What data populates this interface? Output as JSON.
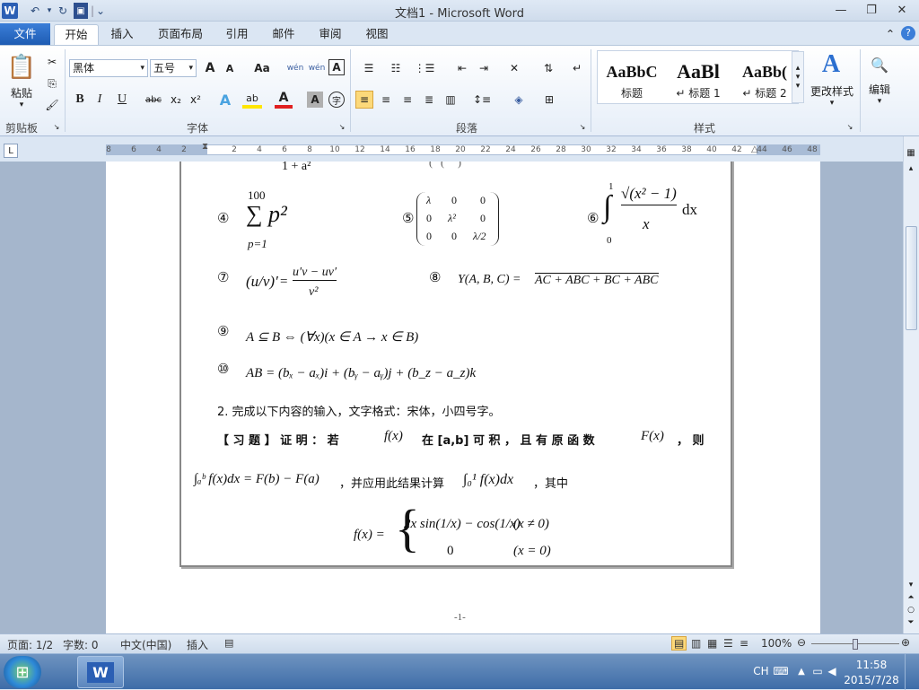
{
  "window": {
    "title": "文档1 - Microsoft Word",
    "app_icon": "W",
    "qat_separator": "|",
    "qat_more": "⌄",
    "controls": {
      "minimize": "—",
      "restore": "❐",
      "close": "✕"
    }
  },
  "tabs": [
    "文件",
    "开始",
    "插入",
    "页面布局",
    "引用",
    "邮件",
    "审阅",
    "视图"
  ],
  "ribbon": {
    "clipboard": {
      "paste": "粘贴",
      "group": "剪贴板"
    },
    "font": {
      "name": "黑体",
      "size": "五号",
      "group": "字体",
      "grow": "A",
      "shrink": "A",
      "change_case": "Aa",
      "clear_format": "wén",
      "phonetic": "wén",
      "border_char": "A",
      "bold": "B",
      "italic": "I",
      "underline": "U",
      "strike": "abc",
      "sub": "x₂",
      "sup": "x²",
      "effects": "A",
      "highlight": "ab",
      "font_color": "A",
      "char_shade": "A",
      "enclose": "字"
    },
    "paragraph": {
      "group": "段落"
    },
    "styles": {
      "group": "样式",
      "items": [
        {
          "sample": "AaBbC",
          "label": "标题"
        },
        {
          "sample": "AaBl",
          "label": "↵ 标题 1"
        },
        {
          "sample": "AaBb(",
          "label": "↵ 标题 2"
        }
      ],
      "change_styles": "更改样式"
    },
    "editing": {
      "group": "编辑",
      "binoculars": "🔍"
    }
  },
  "ruler": {
    "ticks": [
      "8",
      "6",
      "4",
      "2",
      "2",
      "4",
      "6",
      "8",
      "10",
      "12",
      "14",
      "16",
      "18",
      "20",
      "22",
      "24",
      "26",
      "28",
      "30",
      "32",
      "34",
      "36",
      "38",
      "40",
      "42",
      "44",
      "46",
      "48"
    ]
  },
  "document": {
    "cutoff_line": "1 + a²",
    "eq4_label": "④",
    "eq4_top": "100",
    "eq4_body": "∑ p²",
    "eq4_bottom": "p=1",
    "eq5_label": "⑤",
    "eq5_matrix": [
      [
        "λ",
        "0",
        "0"
      ],
      [
        "0",
        "λ²",
        "0"
      ],
      [
        "0",
        "0",
        "λ/2"
      ]
    ],
    "eq6_label": "⑥",
    "eq6_upper": "1",
    "eq6_lower": "0",
    "eq6_num": "√(x² − 1)",
    "eq6_den": "x",
    "eq6_dx": "dx",
    "eq7_label": "⑦",
    "eq7_lhs": "(u/v)′",
    "eq7_eq": "=",
    "eq7_num": "u′v − uv′",
    "eq7_den": "v²",
    "eq8_label": "⑧",
    "eq8_lhs": "Y(A, B, C) =",
    "eq8_rhs": "AC + ABC + BC + ABC",
    "eq9_label": "⑨",
    "eq9": "A ⊆ B ⇔ (∀x)(x ∈ A → x ∈ B)",
    "eq10_label": "⑩",
    "eq10": "AB = (bₓ − aₓ)i + (bᵧ − aᵧ)j + (b_z − a_z)k",
    "item2": "2.  完成以下内容的输入，文字格式：宋体，小四号字。",
    "exercise_line1_a": "【 习 题 】 证 明 ： 若",
    "exercise_fx1": "f(x)",
    "exercise_line1_b": "在 [a,b] 可 积 ， 且 有 原 函 数",
    "exercise_Fx": "F(x)",
    "exercise_line1_c": "， 则",
    "line2_integral": "∫ₐᵇ f(x)dx = F(b) − F(a)",
    "line2_text": "，并应用此结果计算",
    "line2_integral2": "∫₀¹ f(x)dx",
    "line2_tail": "，其中",
    "piece_lhs": "f(x) =",
    "piece_row1": "2x sin(1/x) − cos(1/x)",
    "piece_cond1": "(x ≠ 0)",
    "piece_row2": "0",
    "piece_cond2": "(x = 0)",
    "page_number": "-1-"
  },
  "status": {
    "page": "页面: 1/2",
    "words": "字数: 0",
    "lang": "中文(中国)",
    "mode": "插入",
    "zoom": "100%"
  },
  "taskbar": {
    "ime": "CH",
    "time": "11:58",
    "date": "2015/7/28"
  }
}
